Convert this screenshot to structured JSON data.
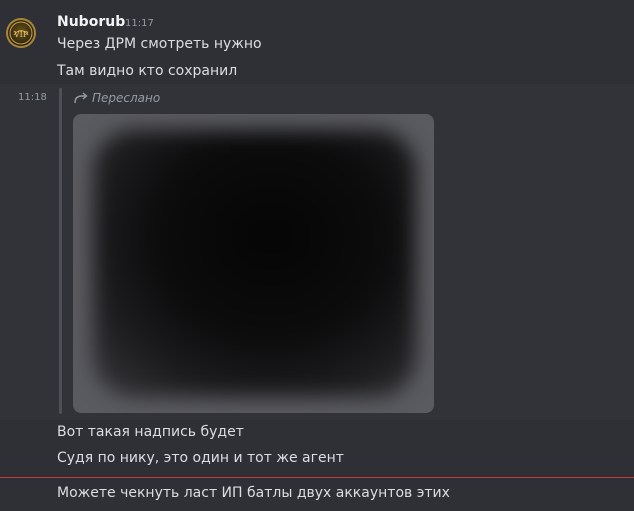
{
  "author": {
    "name": "Nuborub",
    "timestamp": "11:17",
    "avatar_icon": "vip-avatar-icon"
  },
  "messages": [
    {
      "text": "Через ДРМ смотреть нужно"
    },
    {
      "text": "Там видно кто сохранил"
    }
  ],
  "forwarded": {
    "timestamp": "11:18",
    "label": "Переслано",
    "image": "blurred-image"
  },
  "messages_after": [
    {
      "text": "Вот такая надпись будет"
    },
    {
      "text": "Судя по нику, это один и тот же агент"
    },
    {
      "text": "Можете чекнуть ласт ИП батлы двух аккаунтов этих"
    }
  ],
  "colors": {
    "background": "#313338",
    "highlight": "#2e3035",
    "new_divider": "#c9353f"
  }
}
